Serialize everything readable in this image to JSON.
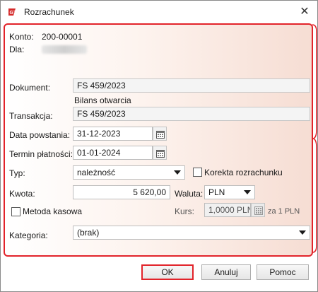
{
  "window": {
    "title": "Rozrachunek"
  },
  "header": {
    "konto_label": "Konto:",
    "konto_value": "200-00001",
    "dla_label": "Dla:"
  },
  "form": {
    "dokument_label": "Dokument:",
    "dokument_value": "FS 459/2023",
    "bilans_note": "Bilans otwarcia",
    "transakcja_label": "Transakcja:",
    "transakcja_value": "FS 459/2023",
    "data_powstania_label": "Data powstania:",
    "data_powstania_value": "31-12-2023",
    "termin_label": "Termin płatności:",
    "termin_value": "01-01-2024",
    "typ_label": "Typ:",
    "typ_value": "należność",
    "korekta_label": "Korekta rozrachunku",
    "kwota_label": "Kwota:",
    "kwota_value": "5 620,00",
    "waluta_label": "Waluta:",
    "waluta_value": "PLN",
    "metoda_label": "Metoda kasowa",
    "kurs_label": "Kurs:",
    "kurs_value": "1,0000 PLN",
    "kurs_unit": "za 1 PLN",
    "kategoria_label": "Kategoria:",
    "kategoria_value": "(brak)"
  },
  "buttons": {
    "ok": "OK",
    "anuluj": "Anuluj",
    "pomoc": "Pomoc"
  },
  "colors": {
    "highlight": "#e2232a",
    "panel_gradient_end": "#f6ddd3"
  }
}
